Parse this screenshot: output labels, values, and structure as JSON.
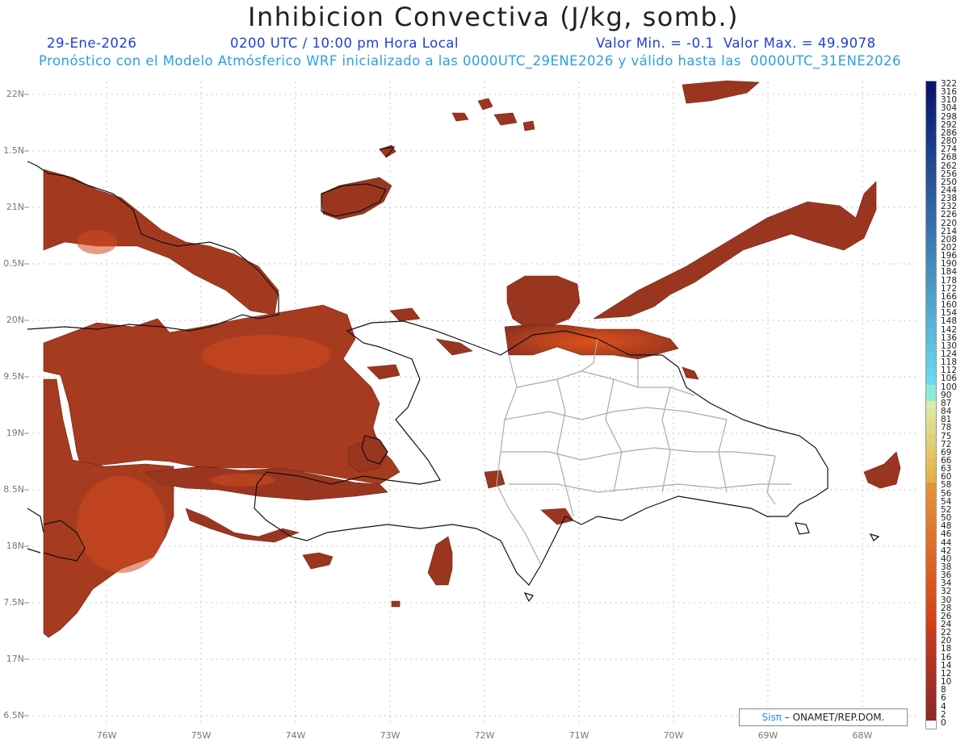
{
  "header": {
    "title": "Inhibicion Convectiva (J/kg, somb.)",
    "date": "29-Ene-2026",
    "time": "0200 UTC / 10:00 pm Hora Local",
    "minmax": "Valor Min. = -0.1  Valor Max. = 49.9078",
    "forecast": "Pronóstico con el Modelo Atmósferico WRF inicializado a las 0000UTC_29ENE2026 y válido hasta las  0000UTC_31ENE2026"
  },
  "axes": {
    "lat_labels": [
      "22N",
      "1.5N",
      "21N",
      "0.5N",
      "20N",
      "9.5N",
      "19N",
      "8.5N",
      "18N",
      "7.5N",
      "17N",
      "6.5N"
    ],
    "lon_labels": [
      "76W",
      "75W",
      "74W",
      "73W",
      "72W",
      "71W",
      "70W",
      "69W",
      "68W"
    ]
  },
  "legend": {
    "labels": [
      "322",
      "316",
      "310",
      "304",
      "298",
      "292",
      "286",
      "280",
      "274",
      "268",
      "262",
      "256",
      "250",
      "244",
      "238",
      "232",
      "226",
      "220",
      "214",
      "208",
      "202",
      "196",
      "190",
      "184",
      "178",
      "172",
      "166",
      "160",
      "154",
      "148",
      "142",
      "136",
      "130",
      "124",
      "118",
      "112",
      "106",
      "100",
      "90",
      "87",
      "84",
      "81",
      "78",
      "75",
      "72",
      "69",
      "66",
      "63",
      "60",
      "58",
      "56",
      "54",
      "52",
      "50",
      "48",
      "46",
      "44",
      "42",
      "40",
      "38",
      "36",
      "34",
      "32",
      "30",
      "28",
      "26",
      "24",
      "22",
      "20",
      "18",
      "16",
      "14",
      "12",
      "10",
      "8",
      "6",
      "4",
      "2",
      "0"
    ]
  },
  "credit": {
    "sis": "Sisπ",
    "org": " – ONAMET/REP.DOM."
  }
}
